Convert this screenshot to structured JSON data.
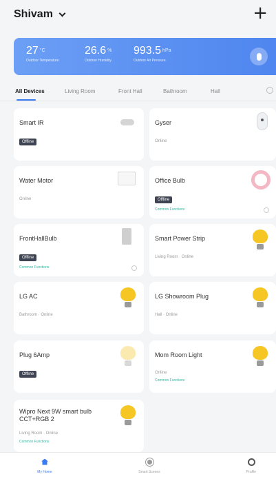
{
  "header": {
    "home_name": "Shivam"
  },
  "weather": {
    "temperature": "27",
    "temperature_unit": "°C",
    "temperature_label": "Outdoor Temperature",
    "humidity": "26.6",
    "humidity_unit": "%",
    "humidity_label": "Outdoor Humidity",
    "pressure": "993.5",
    "pressure_unit": "hPa",
    "pressure_label": "Outdoor Air Pressure"
  },
  "tabs": [
    "All Devices",
    "Living Room",
    "Front Hall",
    "Bathroom",
    "Hall"
  ],
  "devices": [
    {
      "name": "Smart IR",
      "offline": "Offline",
      "icon": "ir-remote-icon"
    },
    {
      "name": "Gyser",
      "status": "Online",
      "icon": "gyser-icon"
    },
    {
      "name": "Water Motor",
      "status": "Online",
      "icon": "water-motor-icon"
    },
    {
      "name": "Office Bulb",
      "offline": "Offline",
      "common": "Common Functions",
      "icon": "ring-bulb-icon"
    },
    {
      "name": "FrontHallBulb",
      "offline": "Offline",
      "common": "Common Functions",
      "icon": "panel-icon"
    },
    {
      "name": "Smart Power Strip",
      "status": "Living Room · Online",
      "icon": "bulb-icon"
    },
    {
      "name": "LG AC",
      "status": "Bathroom · Online",
      "icon": "bulb-icon"
    },
    {
      "name": "LG Showroom Plug",
      "status": "Hall · Online",
      "icon": "bulb-icon"
    },
    {
      "name": "Plug 6Amp",
      "offline": "Offline",
      "icon": "bulb-icon"
    },
    {
      "name": "Mom Room Light",
      "status": "Online",
      "common": "Common Functions",
      "icon": "bulb-icon"
    },
    {
      "name_line1": "Wipro Next 9W smart bulb",
      "name_line2": "CCT+RGB 2",
      "status": "Living Room · Online",
      "common": "Common Functions",
      "icon": "bulb-icon"
    }
  ],
  "bottom_nav": [
    "My Home",
    "Smart Scenes",
    "Profile"
  ],
  "colors": {
    "accent": "#3a7af0",
    "weather_gradient_start": "#6c9ff5",
    "offline_badge": "#3f4452",
    "common_functions": "#2fb5a0",
    "bulb": "#f5c624"
  }
}
